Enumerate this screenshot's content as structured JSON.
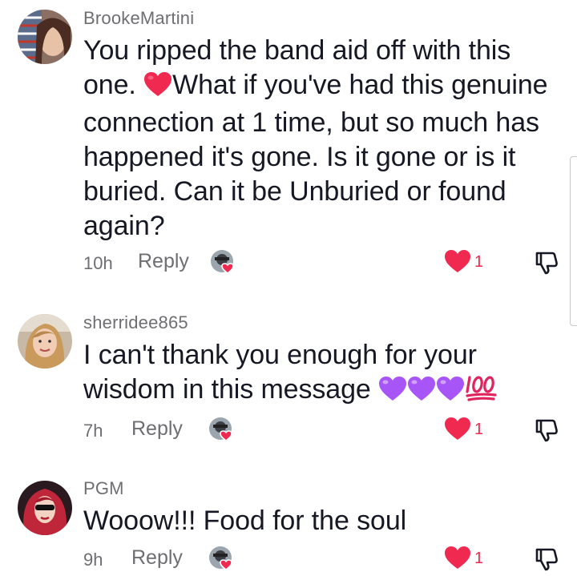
{
  "colors": {
    "like_red": "#ef2950",
    "meta_gray": "#6e6e73",
    "text_dark": "#161823",
    "purple_heart": "#a855f7",
    "hundred_red": "#e0245e"
  },
  "comments": [
    {
      "username": "BrookeMartini",
      "text_part1": "You ripped the band aid off with this one. ",
      "emoji_inline": "red-heart-icon",
      "text_part2": "What if you've had this genuine connection at 1 time, but so much has happened it's gone. Is it gone or is it buried. Can it be Unburied or found again?",
      "time": "10h",
      "reply_label": "Reply",
      "like_count": "1",
      "liked": true
    },
    {
      "username": "sherridee865",
      "text": "I can't thank you enough for your wisdom in this message ",
      "emojis": [
        "purple-heart-icon",
        "purple-heart-icon",
        "purple-heart-icon",
        "hundred-points-icon"
      ],
      "time": "7h",
      "reply_label": "Reply",
      "like_count": "1",
      "liked": true
    },
    {
      "username": "PGM",
      "text": "Wooow!!! Food for the soul",
      "time": "9h",
      "reply_label": "Reply",
      "like_count": "1",
      "liked": true
    }
  ]
}
